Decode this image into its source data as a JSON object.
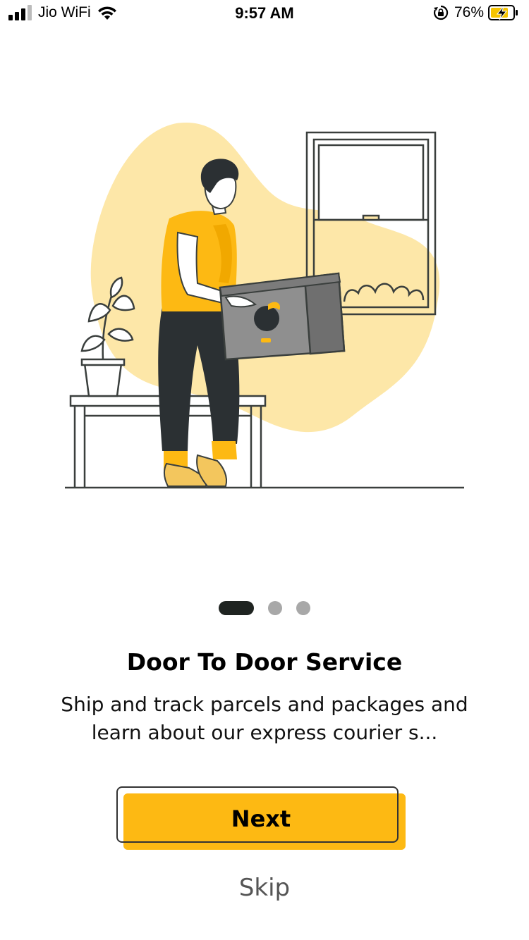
{
  "status_bar": {
    "carrier": "Jio WiFi",
    "time": "9:57 AM",
    "battery_percent": "76%",
    "icons": [
      "signal-icon",
      "wifi-icon",
      "orientation-lock-icon",
      "battery-charging-icon"
    ]
  },
  "onboarding": {
    "page_index": 0,
    "page_count": 3,
    "illustration_icon": "delivery-man-carrying-box-illustration",
    "title": "Door To Door Service",
    "description": "Ship and track parcels and packages and learn about our express courier s...",
    "next_label": "Next",
    "skip_label": "Skip"
  },
  "colors": {
    "accent": "#fdb913",
    "blob": "#fde7a8",
    "active_dot": "#1f2421",
    "inactive_dot": "#a8a8a8",
    "outline": "#333333"
  }
}
